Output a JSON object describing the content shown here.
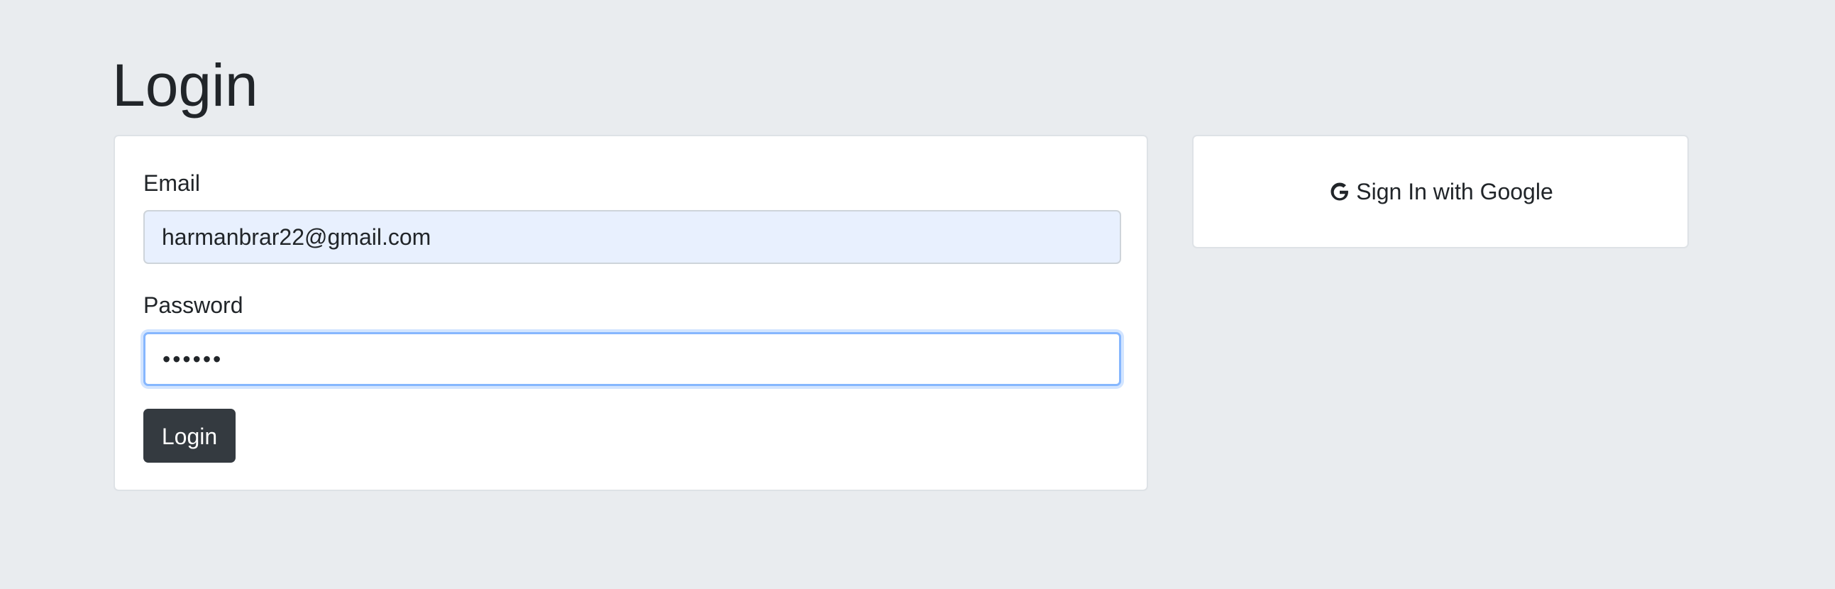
{
  "page": {
    "title": "Login"
  },
  "login_form": {
    "email_label": "Email",
    "email_value": "harmanbrar22@gmail.com",
    "password_label": "Password",
    "password_value": "••••••",
    "submit_label": "Login"
  },
  "google_signin": {
    "icon": "google-g-icon",
    "label": "Sign In with Google"
  },
  "colors": {
    "background": "#e9ecef",
    "card": "#ffffff",
    "button": "#343a40",
    "autofill": "#e8f0fe",
    "focus_border": "#86b7fe"
  }
}
